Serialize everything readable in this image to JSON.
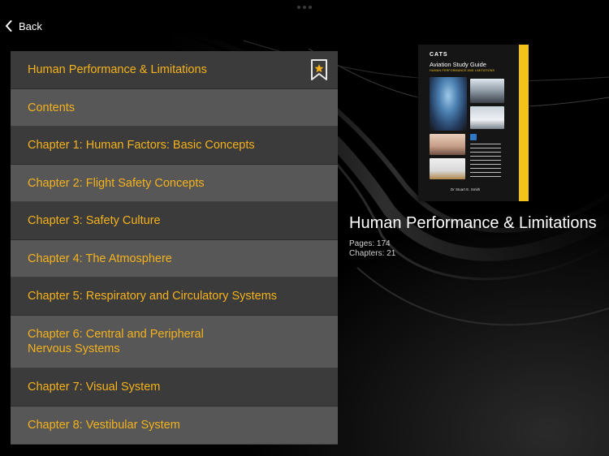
{
  "nav": {
    "back_label": "Back"
  },
  "toc": {
    "items": [
      {
        "label": "Human Performance & Limitations",
        "bookmarked": true
      },
      {
        "label": "Contents"
      },
      {
        "label": "Chapter 1: Human Factors: Basic Concepts"
      },
      {
        "label": "Chapter 2: Flight Safety Concepts"
      },
      {
        "label": "Chapter 3: Safety Culture"
      },
      {
        "label": "Chapter 4: The Atmosphere"
      },
      {
        "label": "Chapter 5: Respiratory and Circulatory Systems"
      },
      {
        "label": "Chapter 6: Central and Peripheral Nervous Systems"
      },
      {
        "label": "Chapter 7: Visual System"
      },
      {
        "label": "Chapter 8: Vestibular System"
      }
    ]
  },
  "book": {
    "cover": {
      "brand": "CATS",
      "series": "Aviation Study Guide",
      "subtitle": "HUMAN PERFORMANCE AND LIMITATIONS",
      "author": "Dr Stuart E. Smith"
    },
    "title": "Human Performance & Limitations",
    "pages": "Pages: 174",
    "chapters": "Chapters: 21"
  },
  "colors": {
    "background": "#000000",
    "row_dark": "#3b3b3b",
    "row_light": "#575757",
    "accent": "#f5b21c"
  },
  "icons": {
    "back": "chevron-left-icon",
    "bookmark": "bookmark-star-icon"
  }
}
